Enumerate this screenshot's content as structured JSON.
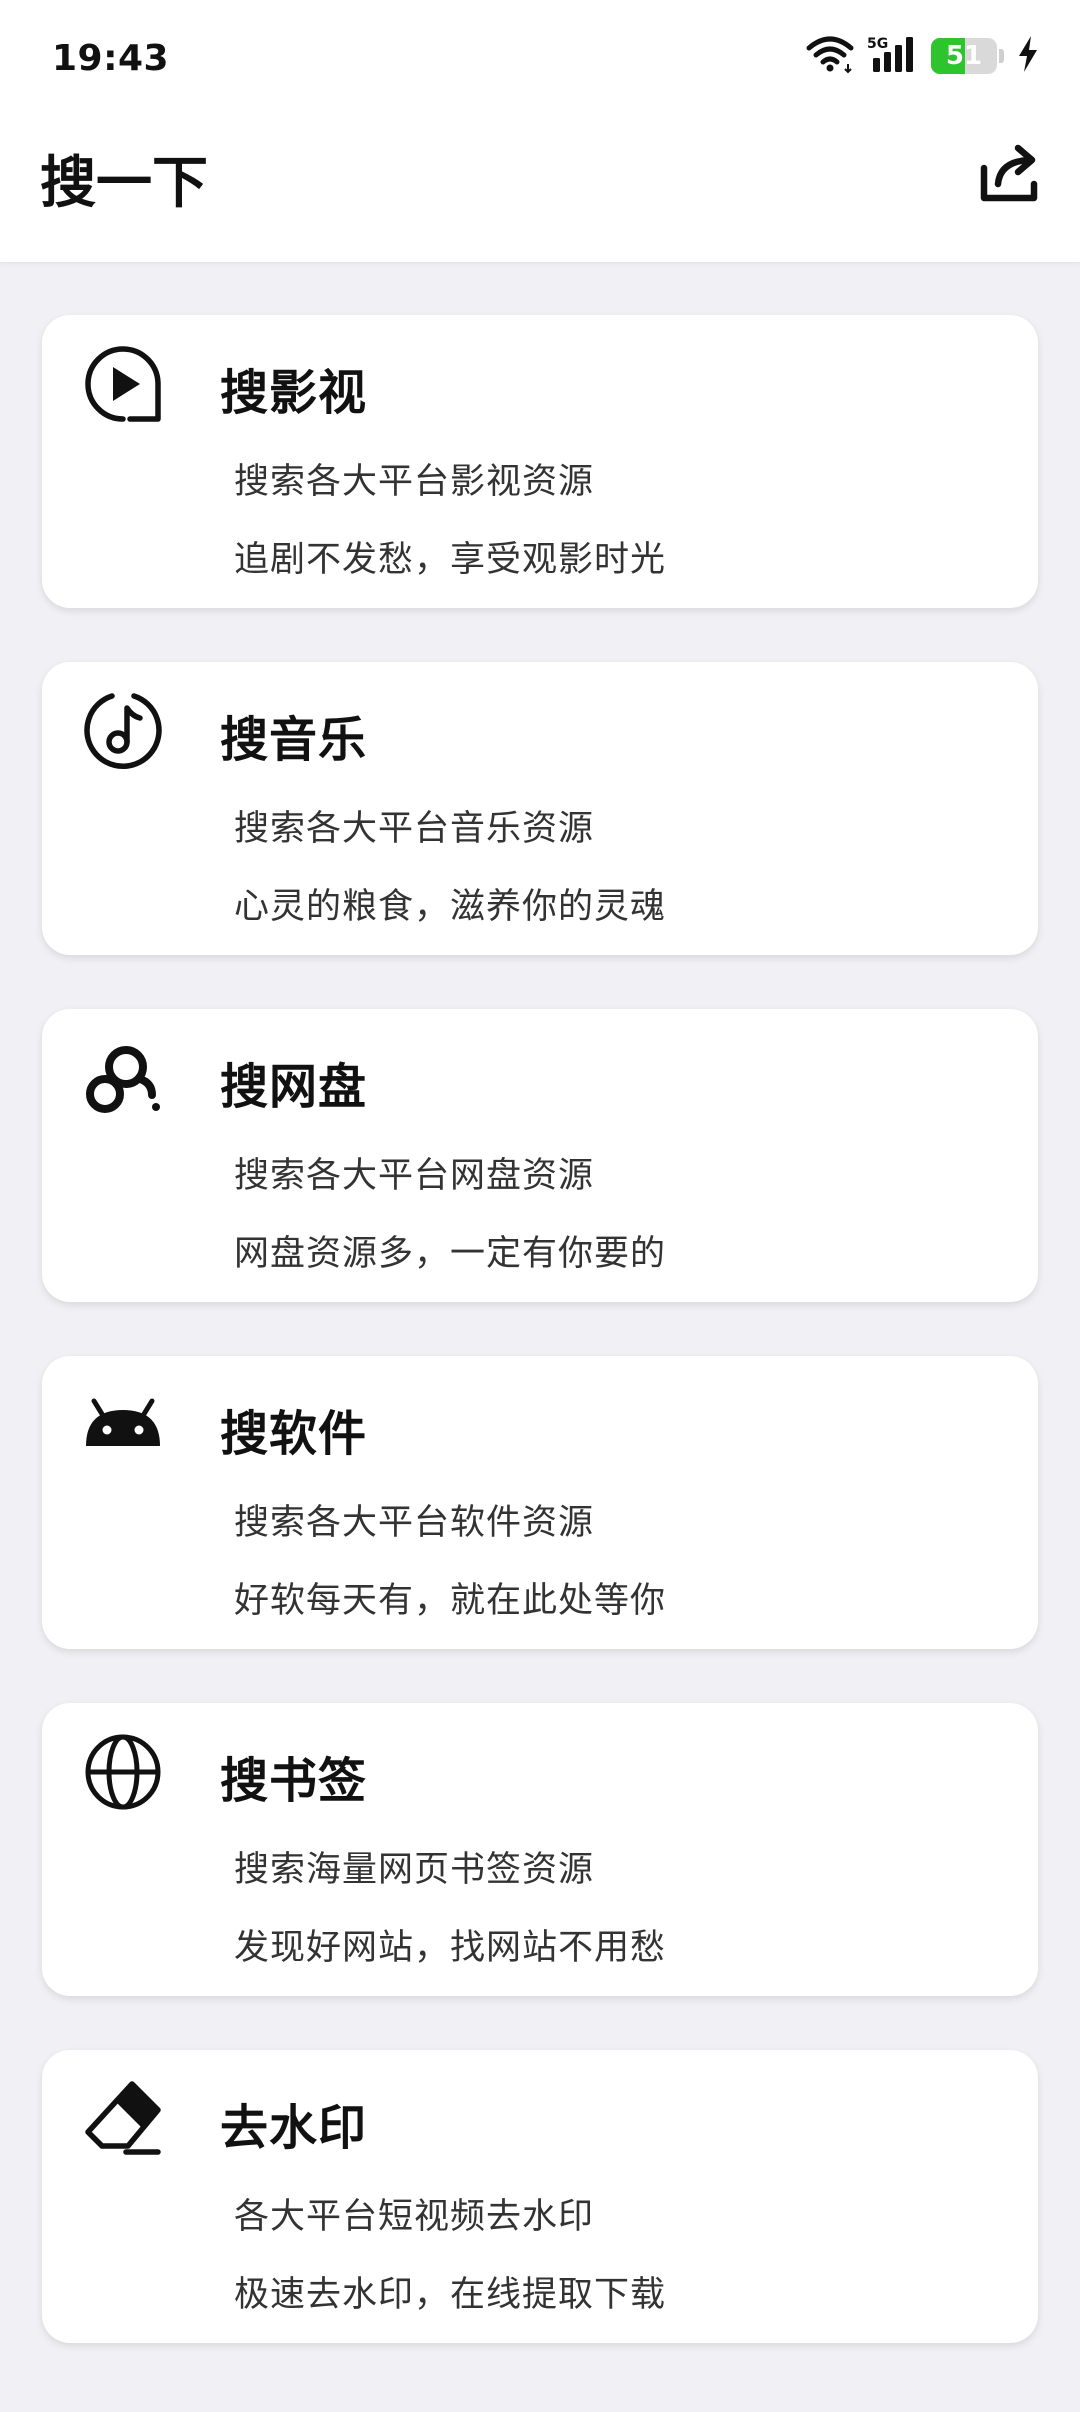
{
  "status_bar": {
    "time": "19:43",
    "network": "5G",
    "battery_level": 51,
    "battery_text": "51",
    "battery_color": "#2ec42e",
    "icons": [
      "wifi-icon",
      "cellular-signal-icon",
      "battery-icon",
      "charging-bolt-icon"
    ]
  },
  "header": {
    "title": "搜一下",
    "share_icon": "share-icon"
  },
  "cards": [
    {
      "id": "video",
      "icon": "play-circle-icon",
      "title": "搜影视",
      "line1": "搜索各大平台影视资源",
      "line2": "追剧不发愁，享受观影时光"
    },
    {
      "id": "music",
      "icon": "music-note-icon",
      "title": "搜音乐",
      "line1": "搜索各大平台音乐资源",
      "line2": "心灵的粮食，滋养你的灵魂"
    },
    {
      "id": "netdisk",
      "icon": "cloud-disk-icon",
      "title": "搜网盘",
      "line1": "搜索各大平台网盘资源",
      "line2": "网盘资源多，一定有你要的"
    },
    {
      "id": "software",
      "icon": "android-icon",
      "title": "搜软件",
      "line1": "搜索各大平台软件资源",
      "line2": "好软每天有，就在此处等你"
    },
    {
      "id": "bookmark",
      "icon": "globe-icon",
      "title": "搜书签",
      "line1": "搜索海量网页书签资源",
      "line2": "发现好网站，找网站不用愁"
    },
    {
      "id": "watermark",
      "icon": "eraser-icon",
      "title": "去水印",
      "line1": "各大平台短视频去水印",
      "line2": "极速去水印，在线提取下载"
    }
  ]
}
